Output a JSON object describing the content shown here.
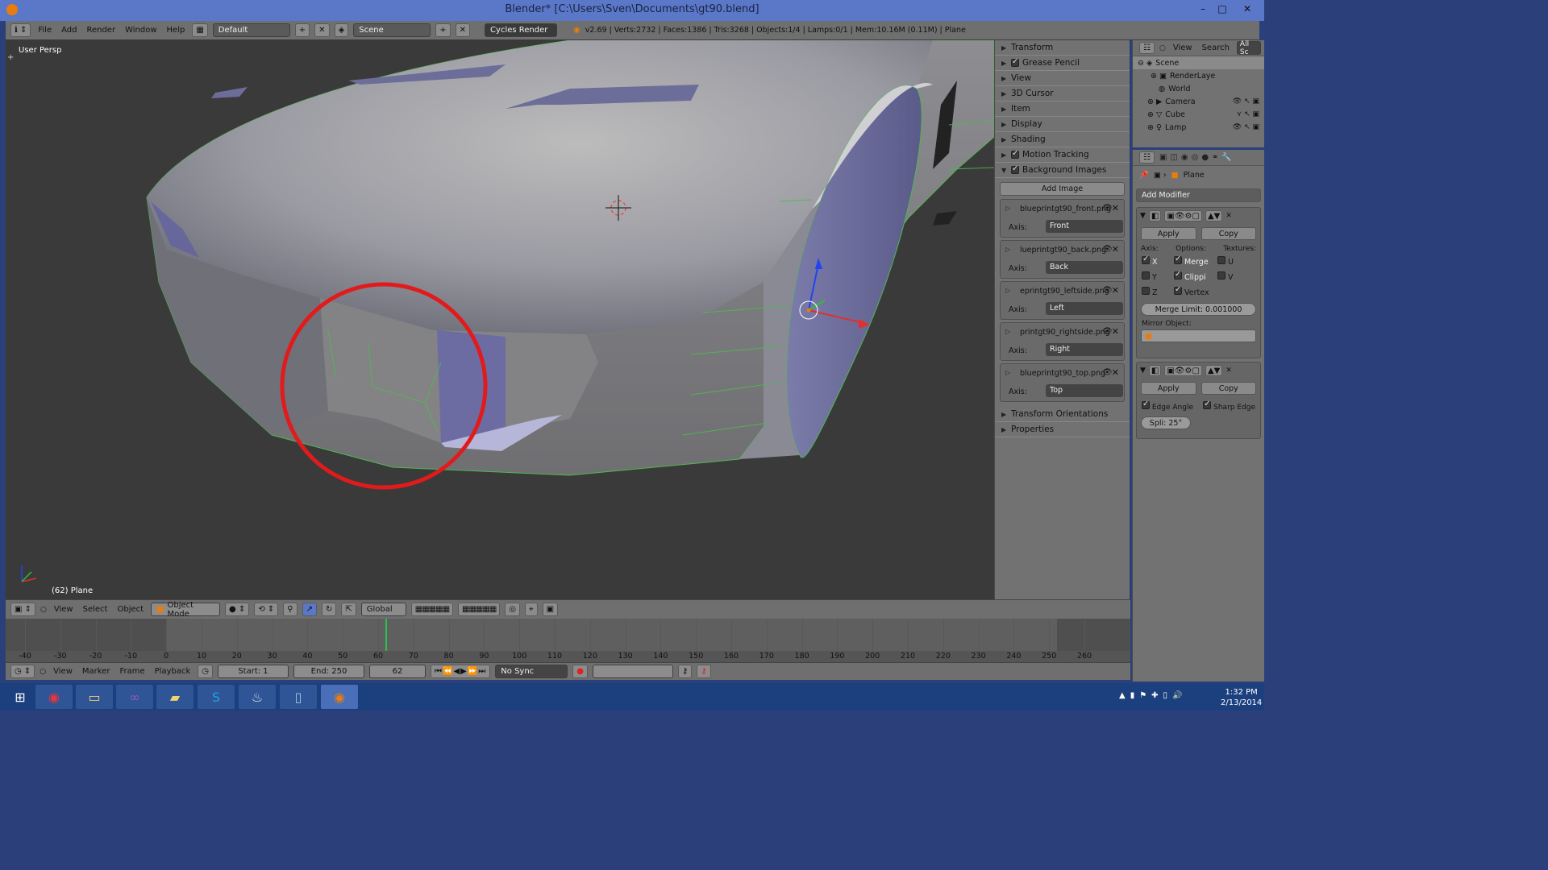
{
  "window": {
    "title": "Blender* [C:\\Users\\Sven\\Documents\\gt90.blend]",
    "minimize": "–",
    "maximize": "□",
    "close": "✕"
  },
  "topbar": {
    "menus": [
      "File",
      "Add",
      "Render",
      "Window",
      "Help"
    ],
    "layout": "Default",
    "scene": "Scene",
    "engine": "Cycles Render",
    "stats": "v2.69 | Verts:2732 | Faces:1386 | Tris:3268 | Objects:1/4 | Lamps:0/1 | Mem:10.16M (0.11M) | Plane"
  },
  "viewport": {
    "view_label": "User Persp",
    "object_label": "(62) Plane"
  },
  "npanel": {
    "sections_top": [
      {
        "label": "Transform",
        "checkbox": false
      },
      {
        "label": "Grease Pencil",
        "checkbox": true
      },
      {
        "label": "View",
        "checkbox": false
      },
      {
        "label": "3D Cursor",
        "checkbox": false
      },
      {
        "label": "Item",
        "checkbox": false
      },
      {
        "label": "Display",
        "checkbox": false
      },
      {
        "label": "Shading",
        "checkbox": false
      },
      {
        "label": "Motion Tracking",
        "checkbox": true
      }
    ],
    "bg_images_label": "Background Images",
    "add_image": "Add Image",
    "axis_label": "Axis:",
    "images": [
      {
        "name": "blueprintgt90_front.png",
        "axis": "Front"
      },
      {
        "name": "lueprintgt90_back.png",
        "axis": "Back"
      },
      {
        "name": "eprintgt90_leftside.png",
        "axis": "Left"
      },
      {
        "name": "printgt90_rightside.png",
        "axis": "Right"
      },
      {
        "name": "blueprintgt90_top.png",
        "axis": "Top"
      }
    ],
    "sections_bottom": [
      "Transform Orientations",
      "Properties"
    ]
  },
  "outliner": {
    "view": "View",
    "search": "Search",
    "filter": "All Sc",
    "items": [
      {
        "label": "Scene",
        "indent": 0
      },
      {
        "label": "RenderLaye",
        "indent": 1
      },
      {
        "label": "World",
        "indent": 1
      },
      {
        "label": "Camera",
        "indent": 1
      },
      {
        "label": "Cube",
        "indent": 1
      },
      {
        "label": "Lamp",
        "indent": 1
      }
    ]
  },
  "properties": {
    "object_name": "Plane",
    "add_modifier": "Add Modifier",
    "mirror": {
      "apply": "Apply",
      "copy": "Copy",
      "axis_label": "Axis:",
      "options_label": "Options:",
      "textures_label": "Textures:",
      "axes": [
        {
          "label": "X",
          "on": true
        },
        {
          "label": "Y",
          "on": false
        },
        {
          "label": "Z",
          "on": false
        }
      ],
      "options": [
        {
          "label": "Merge",
          "on": true
        },
        {
          "label": "Clippi",
          "on": true
        },
        {
          "label": "Vertex",
          "on": true
        }
      ],
      "textures": [
        {
          "label": "U",
          "on": false
        },
        {
          "label": "V",
          "on": false
        }
      ],
      "merge_limit": "Merge Limit: 0.001000",
      "mirror_object_label": "Mirror Object:"
    },
    "edgesplit": {
      "apply": "Apply",
      "copy": "Copy",
      "edge_angle": "Edge Angle",
      "sharp_edge": "Sharp Edge",
      "split_angle": "Spli: 25°"
    }
  },
  "view_header": {
    "menus": [
      "View",
      "Select",
      "Object"
    ],
    "mode": "Object Mode",
    "orientation": "Global"
  },
  "timeline": {
    "ticks": [
      "-40",
      "-30",
      "-20",
      "-10",
      "0",
      "10",
      "20",
      "30",
      "40",
      "50",
      "60",
      "70",
      "80",
      "90",
      "100",
      "110",
      "120",
      "130",
      "140",
      "150",
      "160",
      "170",
      "180",
      "190",
      "200",
      "210",
      "220",
      "230",
      "240",
      "250",
      "260"
    ],
    "current_frame_value": 62
  },
  "timeline_header": {
    "menus": [
      "View",
      "Marker",
      "Frame",
      "Playback"
    ],
    "start": "Start: 1",
    "end": "End: 250",
    "current": "62",
    "sync": "No Sync"
  },
  "taskbar": {
    "time": "1:32 PM",
    "date": "2/13/2014"
  }
}
